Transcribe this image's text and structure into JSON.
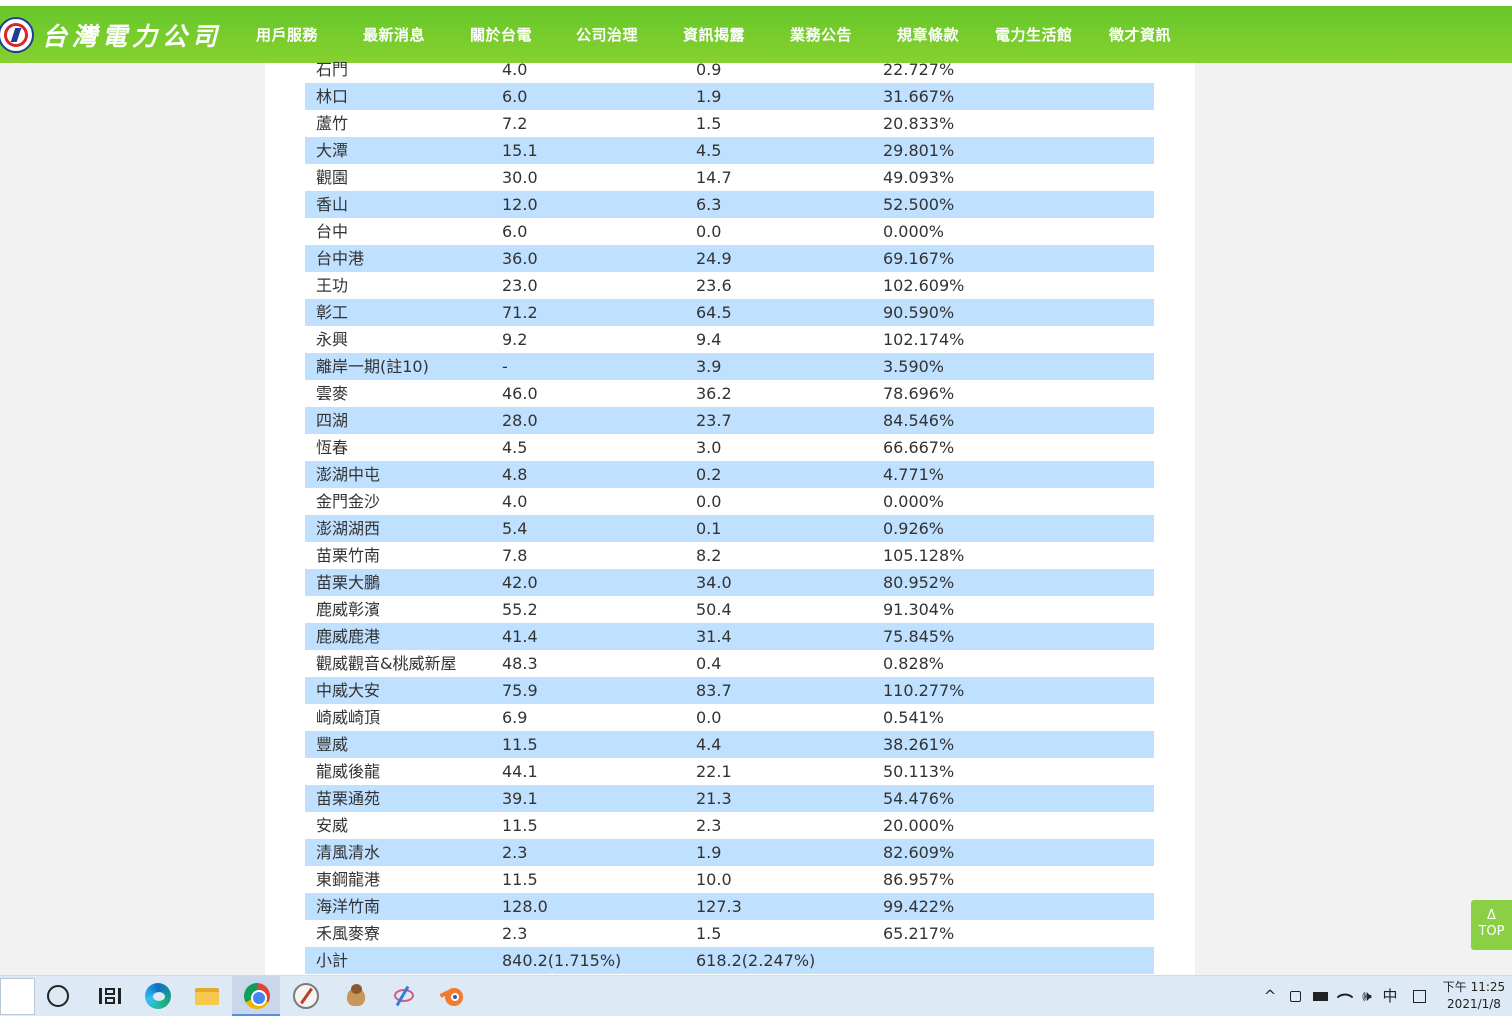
{
  "header": {
    "logo_text": "台灣電力公司",
    "nav": [
      {
        "label": "用戶服務"
      },
      {
        "label": "最新消息"
      },
      {
        "label": "關於台電"
      },
      {
        "label": "公司治理"
      },
      {
        "label": "資訊揭露"
      },
      {
        "label": "業務公告"
      },
      {
        "label": "規章條款"
      },
      {
        "label": "電力生活館"
      },
      {
        "label": "徵才資訊"
      }
    ],
    "active_index": 4
  },
  "table": {
    "rows": [
      [
        "石門",
        "4.0",
        "0.9",
        "22.727%"
      ],
      [
        "林口",
        "6.0",
        "1.9",
        "31.667%"
      ],
      [
        "蘆竹",
        "7.2",
        "1.5",
        "20.833%"
      ],
      [
        "大潭",
        "15.1",
        "4.5",
        "29.801%"
      ],
      [
        "觀園",
        "30.0",
        "14.7",
        "49.093%"
      ],
      [
        "香山",
        "12.0",
        "6.3",
        "52.500%"
      ],
      [
        "台中",
        "6.0",
        "0.0",
        "0.000%"
      ],
      [
        "台中港",
        "36.0",
        "24.9",
        "69.167%"
      ],
      [
        "王功",
        "23.0",
        "23.6",
        "102.609%"
      ],
      [
        "彰工",
        "71.2",
        "64.5",
        "90.590%"
      ],
      [
        "永興",
        "9.2",
        "9.4",
        "102.174%"
      ],
      [
        "離岸一期(註10)",
        "-",
        "3.9",
        "3.590%"
      ],
      [
        "雲麥",
        "46.0",
        "36.2",
        "78.696%"
      ],
      [
        "四湖",
        "28.0",
        "23.7",
        "84.546%"
      ],
      [
        "恆春",
        "4.5",
        "3.0",
        "66.667%"
      ],
      [
        "澎湖中屯",
        "4.8",
        "0.2",
        "4.771%"
      ],
      [
        "金門金沙",
        "4.0",
        "0.0",
        "0.000%"
      ],
      [
        "澎湖湖西",
        "5.4",
        "0.1",
        "0.926%"
      ],
      [
        "苗栗竹南",
        "7.8",
        "8.2",
        "105.128%"
      ],
      [
        "苗栗大鵬",
        "42.0",
        "34.0",
        "80.952%"
      ],
      [
        "鹿威彰濱",
        "55.2",
        "50.4",
        "91.304%"
      ],
      [
        "鹿威鹿港",
        "41.4",
        "31.4",
        "75.845%"
      ],
      [
        "觀威觀音&桃威新屋",
        "48.3",
        "0.4",
        "0.828%"
      ],
      [
        "中威大安",
        "75.9",
        "83.7",
        "110.277%"
      ],
      [
        "崎威崎頂",
        "6.9",
        "0.0",
        "0.541%"
      ],
      [
        "豐威",
        "11.5",
        "4.4",
        "38.261%"
      ],
      [
        "龍威後龍",
        "44.1",
        "22.1",
        "50.113%"
      ],
      [
        "苗栗通苑",
        "39.1",
        "21.3",
        "54.476%"
      ],
      [
        "安威",
        "11.5",
        "2.3",
        "20.000%"
      ],
      [
        "清風清水",
        "2.3",
        "1.9",
        "82.609%"
      ],
      [
        "東鋼龍港",
        "11.5",
        "10.0",
        "86.957%"
      ],
      [
        "海洋竹南",
        "128.0",
        "127.3",
        "99.422%"
      ],
      [
        "禾風麥寮",
        "2.3",
        "1.5",
        "65.217%"
      ],
      [
        "小計",
        "840.2(1.715%)",
        "618.2(2.247%)",
        ""
      ]
    ]
  },
  "back_to_top": {
    "arrow": "Δ",
    "label": "TOP"
  },
  "taskbar": {
    "apps": [
      "cortana",
      "task-view",
      "edge",
      "file-explorer",
      "chrome",
      "compass-app",
      "bird-app",
      "ink-app",
      "blender"
    ],
    "active_app": "chrome",
    "tray": {
      "chevron": "^",
      "ime": "中",
      "volume": "🕪"
    },
    "clock_time": "下午 11:25",
    "clock_date": "2021/1/8"
  },
  "colors": {
    "header_green": "#67c72b",
    "row_alt": "#bfe0ff",
    "top_button": "#8bcf45"
  }
}
